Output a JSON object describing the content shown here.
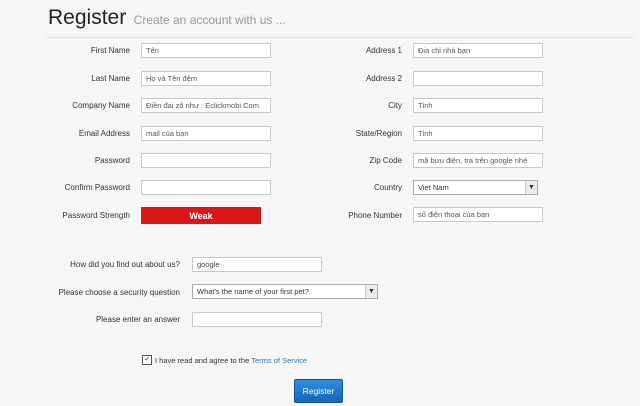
{
  "header": {
    "title": "Register",
    "subtitle": "Create an account with us ..."
  },
  "left_fields": {
    "first_name": {
      "label": "First Name",
      "placeholder": "Tên"
    },
    "last_name": {
      "label": "Last Name",
      "placeholder": "Họ và Tên đệm"
    },
    "company_name": {
      "label": "Company Name",
      "placeholder": "Điền đại zô như : Eclickmobi Com"
    },
    "email": {
      "label": "Email Address",
      "placeholder": "mail của bạn"
    },
    "password": {
      "label": "Password",
      "placeholder": ""
    },
    "confirm_password": {
      "label": "Confirm Password",
      "placeholder": ""
    },
    "password_strength": {
      "label": "Password Strength",
      "value": "Weak",
      "color": "#d91515"
    }
  },
  "right_fields": {
    "address1": {
      "label": "Address 1",
      "placeholder": "Địa chỉ nhà bạn"
    },
    "address2": {
      "label": "Address 2",
      "placeholder": ""
    },
    "city": {
      "label": "City",
      "placeholder": "Tỉnh"
    },
    "state": {
      "label": "State/Region",
      "placeholder": "Tỉnh"
    },
    "zip": {
      "label": "Zip Code",
      "placeholder": "mã bưu điện, tra trên google nhé"
    },
    "country": {
      "label": "Country",
      "selected": "Viet Nam"
    },
    "phone": {
      "label": "Phone Number",
      "placeholder": "số điện thoại của bạn"
    }
  },
  "security": {
    "found_us": {
      "label": "How did you find out about us?",
      "value": "google"
    },
    "question": {
      "label": "Please choose a security question",
      "selected": "What's the name of your first pet?"
    },
    "answer": {
      "label": "Please enter an answer",
      "placeholder": ""
    }
  },
  "agreement": {
    "checked": true,
    "text": "I have read and agree to the",
    "link": "Terms of Service"
  },
  "submit": {
    "label": "Register",
    "color": "#1a75cf"
  }
}
